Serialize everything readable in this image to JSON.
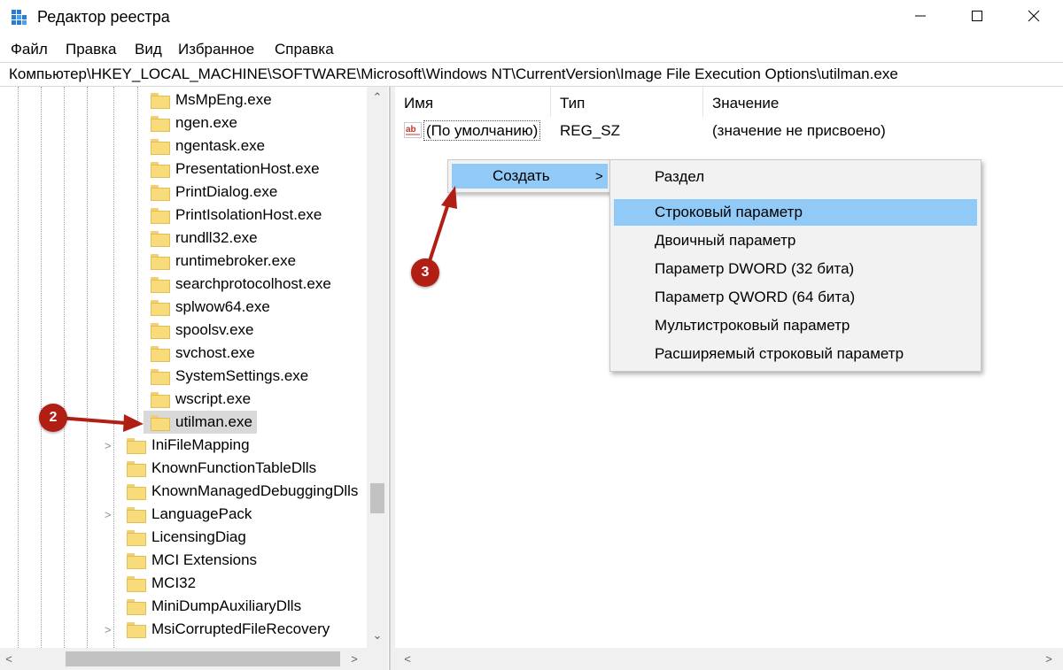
{
  "window": {
    "title": "Редактор реестра",
    "icon": "regedit-icon"
  },
  "menu": [
    "Файл",
    "Правка",
    "Вид",
    "Избранное",
    "Справка"
  ],
  "address": "Компьютер\\HKEY_LOCAL_MACHINE\\SOFTWARE\\Microsoft\\Windows NT\\CurrentVersion\\Image File Execution Options\\utilman.exe",
  "tree": {
    "children": [
      "MsMpEng.exe",
      "ngen.exe",
      "ngentask.exe",
      "PresentationHost.exe",
      "PrintDialog.exe",
      "PrintIsolationHost.exe",
      "rundll32.exe",
      "runtimebroker.exe",
      "searchprotocolhost.exe",
      "splwow64.exe",
      "spoolsv.exe",
      "svchost.exe",
      "SystemSettings.exe",
      "wscript.exe",
      "utilman.exe"
    ],
    "siblings": [
      "IniFileMapping",
      "KnownFunctionTableDlls",
      "KnownManagedDebuggingDlls",
      "LanguagePack",
      "LicensingDiag",
      "MCI Extensions",
      "MCI32",
      "MiniDumpAuxiliaryDlls",
      "MsiCorruptedFileRecovery"
    ]
  },
  "list": {
    "columns": [
      "Имя",
      "Тип",
      "Значение"
    ],
    "rows": [
      {
        "name": "(По умолчанию)",
        "type": "REG_SZ",
        "value": "(значение не присвоено)",
        "icon": "string-value-icon"
      }
    ]
  },
  "context_menu": {
    "create_label": "Создать",
    "submenu": [
      "Раздел",
      "Строковый параметр",
      "Двоичный параметр",
      "Параметр DWORD (32 бита)",
      "Параметр QWORD (64 бита)",
      "Мультистроковый параметр",
      "Расширяемый строковый параметр"
    ]
  },
  "annotations": {
    "badge2": "2",
    "badge3": "3"
  },
  "colors": {
    "highlight": "#91c9f7",
    "badge": "#b01e14",
    "selection": "#d9d9d9"
  }
}
